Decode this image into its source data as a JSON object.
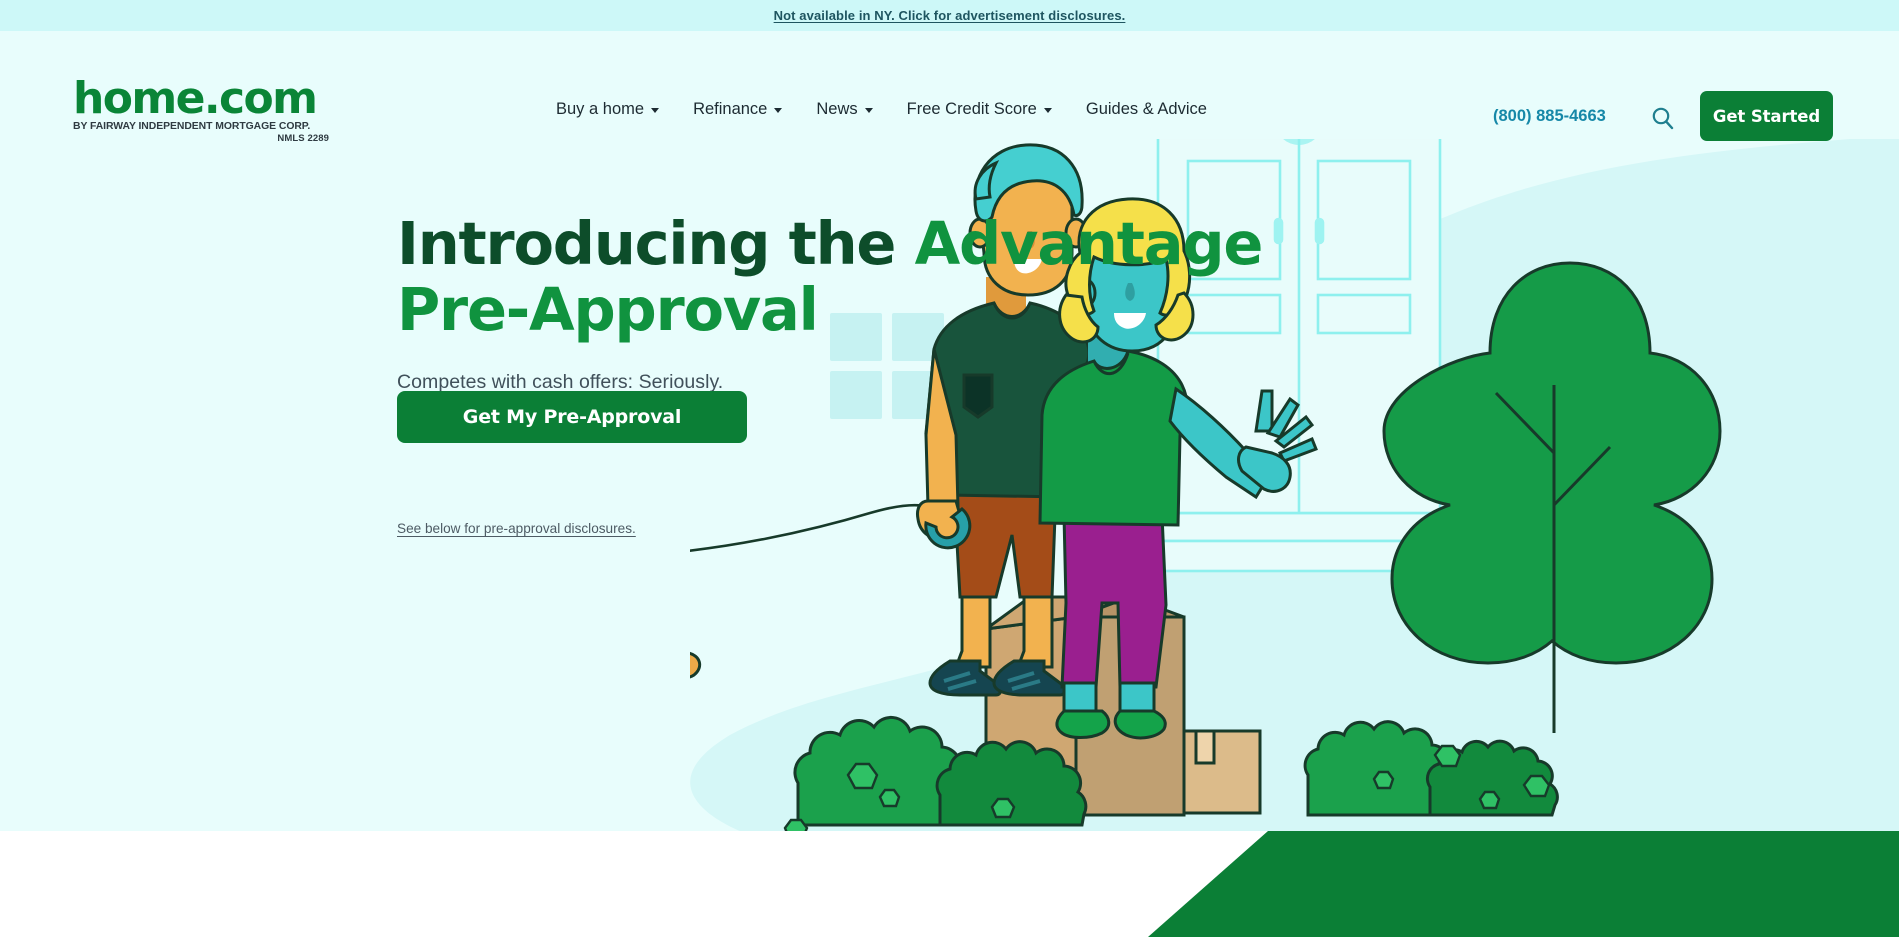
{
  "topbar": {
    "link_text": "Not available in NY. Click for advertisement disclosures.",
    "bg": "#cdf8f8",
    "text_color": "#1e5560"
  },
  "header": {
    "bg": "#e8fdfc",
    "logo": {
      "wordmark": "home.com",
      "tagline": "BY FAIRWAY INDEPENDENT MORTGAGE CORP.",
      "nmls": "NMLS 2289",
      "wordmark_color": "#0a8537"
    },
    "nav": [
      {
        "label": "Buy a home",
        "has_caret": true
      },
      {
        "label": "Refinance",
        "has_caret": true
      },
      {
        "label": "News",
        "has_caret": true
      },
      {
        "label": "Free Credit Score",
        "has_caret": true
      },
      {
        "label": "Guides & Advice",
        "has_caret": false
      }
    ],
    "phone": "(800) 885-4663",
    "phone_color": "#1688a8",
    "search_icon": "search-icon",
    "cta_label": "Get Started",
    "cta_color": "#0b7f36"
  },
  "hero": {
    "bg": "#e8fdfc",
    "headline_part1": "Introducing the ",
    "headline_part2": "Advantage Pre-Approval",
    "headline_color_1": "#0d4d2a",
    "headline_color_2": "#10933f",
    "subhead": "Competes with cash offers: Seriously.",
    "cta_label": "Get My Pre-Approval",
    "cta_color": "#0b7f36",
    "disclosure_link": "See below for pre-approval disclosures.",
    "illustration": {
      "name": "couple-with-dog-in-front-of-house",
      "blob_color": "#d5f7f7",
      "door_stroke": "#8ef0ee",
      "door_fill": "#e3fbfa",
      "tree_color": "#159b48",
      "bush_color": "#1ba14c",
      "bush_dark_color": "#128a3d",
      "box_color": "#cfa772",
      "dog_color": "#eda948",
      "skin_color": "#f2b24f",
      "teal_skin_color": "#3cc6c8",
      "man_shirt_color": "#18543c",
      "man_shorts_color": "#a44c18",
      "man_hair_color": "#45cfd0",
      "woman_shirt_color": "#139b46",
      "woman_pants_color": "#9a1f8f",
      "woman_hair_color": "#f5e04a",
      "outline_color": "#173a2a"
    }
  },
  "bottom": {
    "wedge_color": "#0b7f36",
    "page_bg": "#ffffff"
  }
}
